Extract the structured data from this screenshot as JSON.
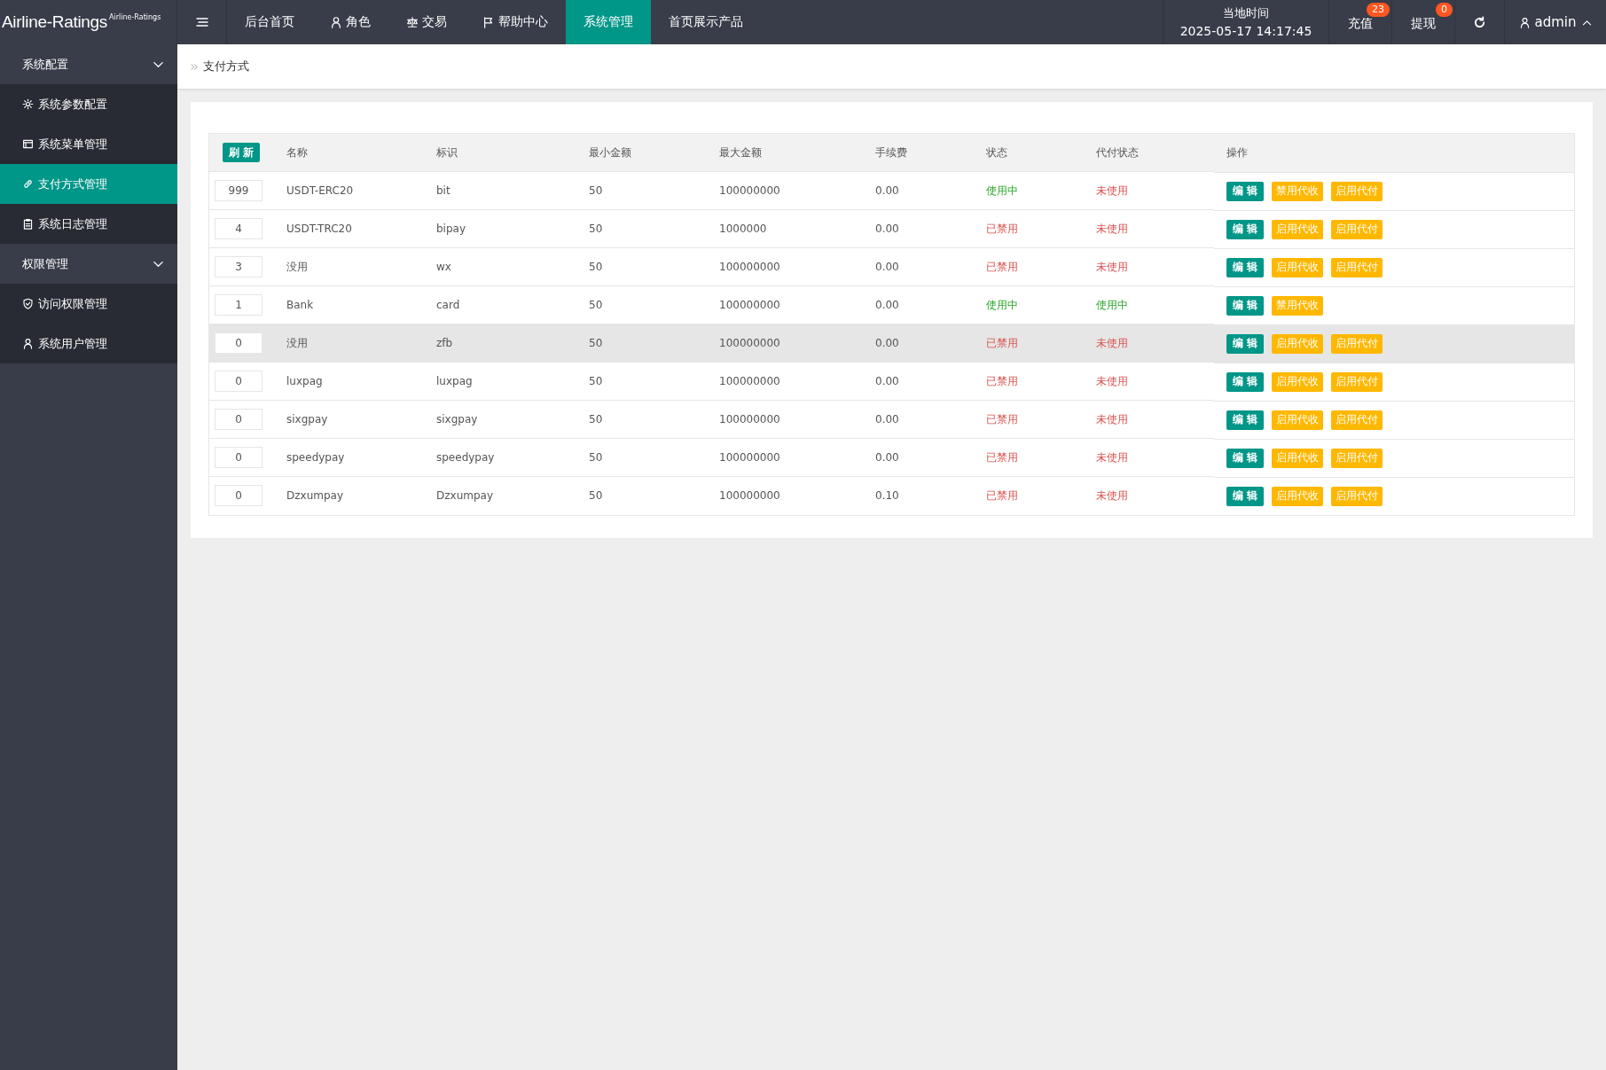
{
  "header": {
    "logo": "Airline-Ratings",
    "logo_sup": "Airline-Ratings",
    "nav": [
      {
        "label": "后台首页",
        "kind": "plain",
        "selected": false
      },
      {
        "label": "角色",
        "kind": "user",
        "selected": false
      },
      {
        "label": "交易",
        "kind": "scale",
        "selected": false
      },
      {
        "label": "帮助中心",
        "kind": "flag",
        "selected": false
      },
      {
        "label": "系统管理",
        "kind": "plain",
        "selected": true
      },
      {
        "label": "首页展示产品",
        "kind": "plain",
        "selected": false
      }
    ],
    "clock": {
      "label": "当地时间",
      "value": "2025-05-17 14:17:45"
    },
    "links": [
      {
        "label": "充值",
        "badge": "23"
      },
      {
        "label": "提现",
        "badge": "0"
      }
    ],
    "user": "admin"
  },
  "sidebar": [
    {
      "label": "系统配置",
      "expanded": true,
      "children": [
        {
          "label": "系统参数配置",
          "kind": "gear",
          "selected": false
        },
        {
          "label": "系统菜单管理",
          "kind": "window",
          "selected": false
        },
        {
          "label": "支付方式管理",
          "kind": "link",
          "selected": true
        },
        {
          "label": "系统日志管理",
          "kind": "clipboard",
          "selected": false
        }
      ]
    },
    {
      "label": "权限管理",
      "expanded": true,
      "children": [
        {
          "label": "访问权限管理",
          "kind": "shield",
          "selected": false
        },
        {
          "label": "系统用户管理",
          "kind": "user",
          "selected": false
        }
      ]
    }
  ],
  "breadcrumb": "支付方式",
  "table": {
    "refresh": "刷 新",
    "columns": [
      "名称",
      "标识",
      "最小金额",
      "最大金额",
      "手续费",
      "状态",
      "代付状态",
      "操作"
    ],
    "rows": [
      {
        "sort": "999",
        "name": "USDT-ERC20",
        "code": "bit",
        "min": "50",
        "max": "100000000",
        "fee": "0.00",
        "status": {
          "text": "使用中",
          "on": true
        },
        "payout": {
          "text": "未使用",
          "on": false
        },
        "hovered": false,
        "actions": [
          {
            "label": "编 辑",
            "kind": "edit"
          },
          {
            "label": "禁用代收",
            "kind": "toggle"
          },
          {
            "label": "启用代付",
            "kind": "toggle"
          }
        ]
      },
      {
        "sort": "4",
        "name": "USDT-TRC20",
        "code": "bipay",
        "min": "50",
        "max": "1000000",
        "fee": "0.00",
        "status": {
          "text": "已禁用",
          "on": false
        },
        "payout": {
          "text": "未使用",
          "on": false
        },
        "hovered": false,
        "actions": [
          {
            "label": "编 辑",
            "kind": "edit"
          },
          {
            "label": "启用代收",
            "kind": "toggle"
          },
          {
            "label": "启用代付",
            "kind": "toggle"
          }
        ]
      },
      {
        "sort": "3",
        "name": "没用",
        "code": "wx",
        "min": "50",
        "max": "100000000",
        "fee": "0.00",
        "status": {
          "text": "已禁用",
          "on": false
        },
        "payout": {
          "text": "未使用",
          "on": false
        },
        "hovered": false,
        "actions": [
          {
            "label": "编 辑",
            "kind": "edit"
          },
          {
            "label": "启用代收",
            "kind": "toggle"
          },
          {
            "label": "启用代付",
            "kind": "toggle"
          }
        ]
      },
      {
        "sort": "1",
        "name": "Bank",
        "code": "card",
        "min": "50",
        "max": "100000000",
        "fee": "0.00",
        "status": {
          "text": "使用中",
          "on": true
        },
        "payout": {
          "text": "使用中",
          "on": true
        },
        "hovered": false,
        "actions": [
          {
            "label": "编 辑",
            "kind": "edit"
          },
          {
            "label": "禁用代收",
            "kind": "toggle"
          }
        ]
      },
      {
        "sort": "0",
        "name": "没用",
        "code": "zfb",
        "min": "50",
        "max": "100000000",
        "fee": "0.00",
        "status": {
          "text": "已禁用",
          "on": false
        },
        "payout": {
          "text": "未使用",
          "on": false
        },
        "hovered": true,
        "actions": [
          {
            "label": "编 辑",
            "kind": "edit"
          },
          {
            "label": "启用代收",
            "kind": "toggle"
          },
          {
            "label": "启用代付",
            "kind": "toggle"
          }
        ]
      },
      {
        "sort": "0",
        "name": "luxpag",
        "code": "luxpag",
        "min": "50",
        "max": "100000000",
        "fee": "0.00",
        "status": {
          "text": "已禁用",
          "on": false
        },
        "payout": {
          "text": "未使用",
          "on": false
        },
        "hovered": false,
        "actions": [
          {
            "label": "编 辑",
            "kind": "edit"
          },
          {
            "label": "启用代收",
            "kind": "toggle"
          },
          {
            "label": "启用代付",
            "kind": "toggle"
          }
        ]
      },
      {
        "sort": "0",
        "name": "sixgpay",
        "code": "sixgpay",
        "min": "50",
        "max": "100000000",
        "fee": "0.00",
        "status": {
          "text": "已禁用",
          "on": false
        },
        "payout": {
          "text": "未使用",
          "on": false
        },
        "hovered": false,
        "actions": [
          {
            "label": "编 辑",
            "kind": "edit"
          },
          {
            "label": "启用代收",
            "kind": "toggle"
          },
          {
            "label": "启用代付",
            "kind": "toggle"
          }
        ]
      },
      {
        "sort": "0",
        "name": "speedypay",
        "code": "speedypay",
        "min": "50",
        "max": "100000000",
        "fee": "0.00",
        "status": {
          "text": "已禁用",
          "on": false
        },
        "payout": {
          "text": "未使用",
          "on": false
        },
        "hovered": false,
        "actions": [
          {
            "label": "编 辑",
            "kind": "edit"
          },
          {
            "label": "启用代收",
            "kind": "toggle"
          },
          {
            "label": "启用代付",
            "kind": "toggle"
          }
        ]
      },
      {
        "sort": "0",
        "name": "Dzxumpay",
        "code": "Dzxumpay",
        "min": "50",
        "max": "100000000",
        "fee": "0.10",
        "status": {
          "text": "已禁用",
          "on": false
        },
        "payout": {
          "text": "未使用",
          "on": false
        },
        "hovered": false,
        "actions": [
          {
            "label": "编 辑",
            "kind": "edit"
          },
          {
            "label": "启用代收",
            "kind": "toggle"
          },
          {
            "label": "启用代付",
            "kind": "toggle"
          }
        ]
      }
    ]
  }
}
